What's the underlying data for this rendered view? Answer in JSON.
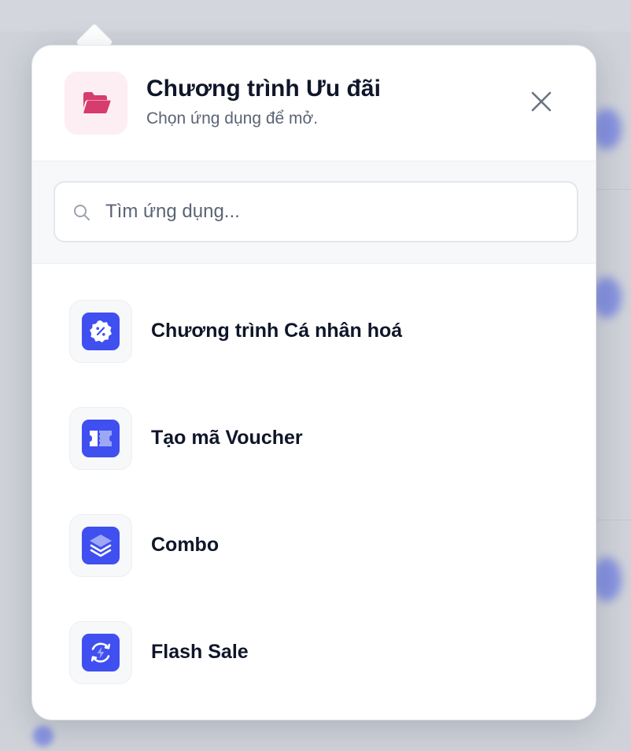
{
  "popover": {
    "title": "Chương trình Ưu đãi",
    "subtitle": "Chọn ứng dụng để mở.",
    "header_icon": "folder-open-icon",
    "close_icon": "close-icon"
  },
  "search": {
    "placeholder": "Tìm ứng dụng...",
    "value": "",
    "icon": "search-icon"
  },
  "apps": [
    {
      "label": "Chương trình Cá nhân hoá",
      "icon": "percent-badge-icon"
    },
    {
      "label": "Tạo mã Voucher",
      "icon": "ticket-icon"
    },
    {
      "label": "Combo",
      "icon": "layers-icon"
    },
    {
      "label": "Flash Sale",
      "icon": "flash-refresh-icon"
    }
  ],
  "colors": {
    "accent": "#3f4ff0",
    "folder": "#d63c6e",
    "folder_bg": "#fdeef3",
    "title_text": "#0f1629",
    "muted_text": "#5b6475"
  }
}
